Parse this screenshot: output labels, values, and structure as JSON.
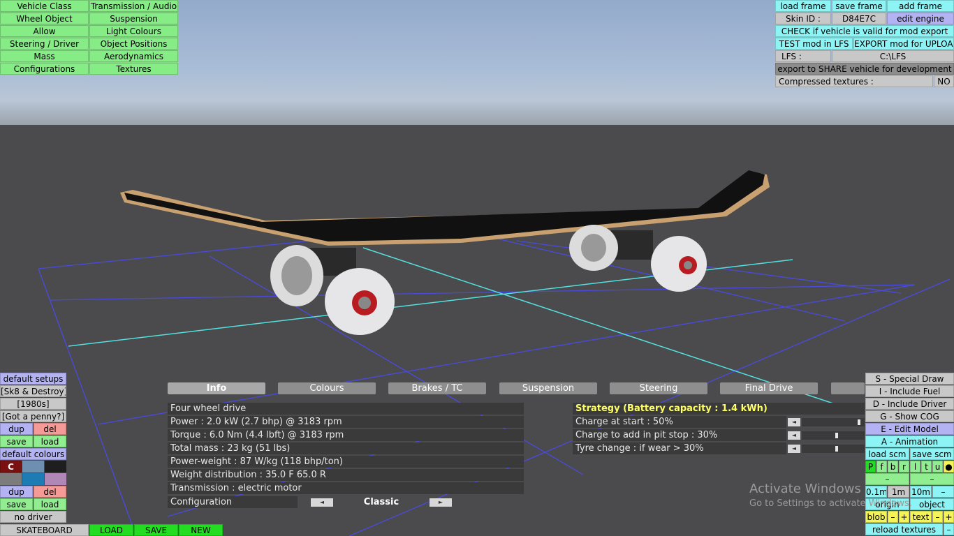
{
  "left_menu": [
    "Vehicle Class",
    "Transmission / Audio",
    "Wheel Object",
    "Suspension",
    "Allow",
    "Light Colours",
    "Steering / Driver",
    "Object Positions",
    "Mass",
    "Aerodynamics",
    "Configurations",
    "Textures"
  ],
  "top_right": {
    "load_frame": "load frame",
    "save_frame": "save frame",
    "add_frame": "add frame",
    "skin_label": "Skin ID :",
    "skin_value": "D84E7C",
    "edit_engine": "edit engine",
    "check": "CHECK if vehicle is valid for mod export",
    "test": "TEST mod in LFS",
    "export": "EXPORT mod for UPLOAD",
    "lfs_label": "LFS :",
    "lfs_path": "C:\\LFS",
    "share": "export to SHARE vehicle for development",
    "compressed_label": "Compressed textures :",
    "compressed_value": "NO"
  },
  "left_bottom": {
    "default_setups": "default setups",
    "setup1": "[Sk8 & Destroy]",
    "setup2": "[1980s]",
    "setup3": "[Got a penny?]",
    "dup": "dup",
    "del": "del",
    "save": "save",
    "load": "load",
    "default_colours": "default colours",
    "c_label": "C",
    "dup2": "dup",
    "del2": "del",
    "save2": "save",
    "load2": "load",
    "no_driver": "no driver"
  },
  "bottom_bar": {
    "name": "SKATEBOARD",
    "load": "LOAD",
    "save": "SAVE",
    "new": "NEW"
  },
  "tabs": [
    "Info",
    "Colours",
    "Brakes / TC",
    "Suspension",
    "Steering",
    "Final Drive"
  ],
  "info_rows": [
    "Four wheel drive",
    "Power : 2.0 kW (2.7 bhp) @ 3183 rpm",
    "Torque : 6.0 Nm (4.4 lbft) @ 3183 rpm",
    "Total mass : 23 kg (51 lbs)",
    "Power-weight : 87 W/kg (118 bhp/ton)",
    "Weight distribution : 35.0 F  65.0 R",
    "Transmission : electric motor"
  ],
  "configuration": {
    "label": "Configuration",
    "value": "Classic"
  },
  "strategy": {
    "title": "Strategy (Battery capacity : 1.4 kWh)",
    "rows": [
      "Charge at start : 50%",
      "Charge to add in pit stop : 30%",
      "Tyre change : if wear > 30%"
    ],
    "levels": [
      1.0,
      0.6,
      0.6
    ]
  },
  "right_panel": {
    "special_draw": "S - Special Draw",
    "include_fuel": "I - Include Fuel",
    "include_driver": "D - Include Driver",
    "show_cog": "G - Show COG",
    "edit_model": "E - Edit Model",
    "animation": "A - Animation",
    "load_scm": "load scm",
    "save_scm": "save scm",
    "letters": [
      "P",
      "f",
      "b",
      "r",
      "l",
      "t",
      "u"
    ],
    "minus": "–",
    "d01": "0.1m",
    "d1": "1m",
    "d10": "10m",
    "origin": "origin",
    "object": "object",
    "blob": "blob",
    "text": "text",
    "plus": "+",
    "reload": "reload textures"
  },
  "watermark": {
    "line1": "Activate Windows",
    "line2": "Go to Settings to activate Windows."
  },
  "colors": {
    "menu_green": "#86ec86",
    "cyan": "#8cf4f4",
    "lavender": "#b3b3f4",
    "pink": "#f59a96",
    "yellow": "#f4f458",
    "strategy_title": "#ffff66"
  }
}
